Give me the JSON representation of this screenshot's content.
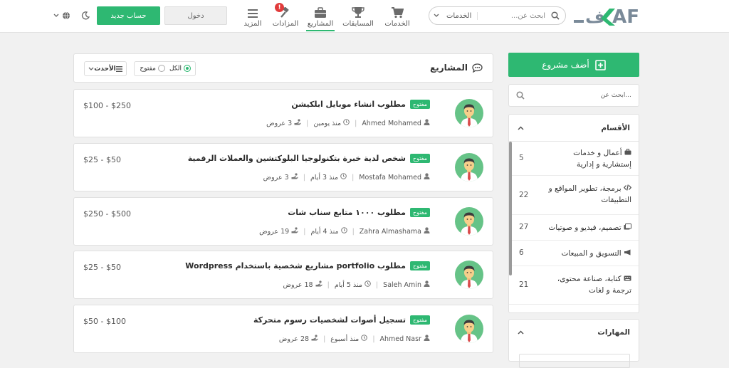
{
  "header": {
    "logo_text": "AF",
    "logo_arabic": "كاف",
    "search": {
      "placeholder": "ابحث عن...",
      "scope": "الخدمات"
    },
    "nav": [
      {
        "label": "الخدمات",
        "icon": "cart-icon"
      },
      {
        "label": "المسابقات",
        "icon": "trophy-icon"
      },
      {
        "label": "المشاريع",
        "icon": "briefcase-icon",
        "active": true
      },
      {
        "label": "المزادات",
        "icon": "gavel-icon",
        "badge": "!"
      },
      {
        "label": "المزيد",
        "icon": "menu-icon"
      }
    ],
    "login_label": "دخول",
    "register_label": "حساب جديد"
  },
  "projects": {
    "title": "المشاريع",
    "filter_all": "الكل",
    "filter_open": "مفتوح",
    "sort_label": "الأحدث",
    "items": [
      {
        "title": "مطلوب انشاء موبايل ابلكيشن",
        "status": "مفتوح",
        "author": "Ahmed Mohamed",
        "time": "منذ يومين",
        "offers": "3 عروض",
        "price": "$100 - $250"
      },
      {
        "title": "شخص لدية خبرة بتكنولوجيا البلوكتشين والعملات الرقمية",
        "status": "مفتوح",
        "author": "Mostafa Mohamed",
        "time": "منذ 3 أيام",
        "offers": "3 عروض",
        "price": "$25 - $50"
      },
      {
        "title": "مطلوب ١٠٠٠ متابع سناب شات",
        "status": "مفتوح",
        "author": "Zahra Almashama",
        "time": "منذ 4 أيام",
        "offers": "19 عروض",
        "price": "$250 - $500"
      },
      {
        "title": "مطلوب portfolio مشاريع شخصية باستخدام Wordpress",
        "status": "مفتوح",
        "author": "Saleh Amin",
        "time": "منذ 5 أيام",
        "offers": "18 عروض",
        "price": "$25 - $50"
      },
      {
        "title": "تسجيل أصوات لشخصيات رسوم متحركة",
        "status": "مفتوح",
        "author": "Ahmed Nasr",
        "time": "منذ أسبوع",
        "offers": "28 عروض",
        "price": "$50 - $100"
      }
    ]
  },
  "sidebar": {
    "add_project_label": "أضف مشروع",
    "search_placeholder": "ابحث عن...",
    "categories_title": "الأقسام",
    "categories": [
      {
        "label": "أعمال و خدمات إستشارية و إدارية",
        "count": "5",
        "icon": "briefcase-icon"
      },
      {
        "label": "برمجة، تطوير المواقع و التطبيقات",
        "count": "22",
        "icon": "code-icon"
      },
      {
        "label": "تصميم، فيديو و صوتيات",
        "count": "27",
        "icon": "images-icon"
      },
      {
        "label": "التسويق و المبيعات",
        "count": "6",
        "icon": "megaphone-icon"
      },
      {
        "label": "كتابة، صناعة محتوى، ترجمة و لغات",
        "count": "21",
        "icon": "keyboard-icon"
      }
    ],
    "skills_title": "المهارات"
  },
  "colors": {
    "accent": "#2eb872",
    "badge": "#e13b3b"
  }
}
